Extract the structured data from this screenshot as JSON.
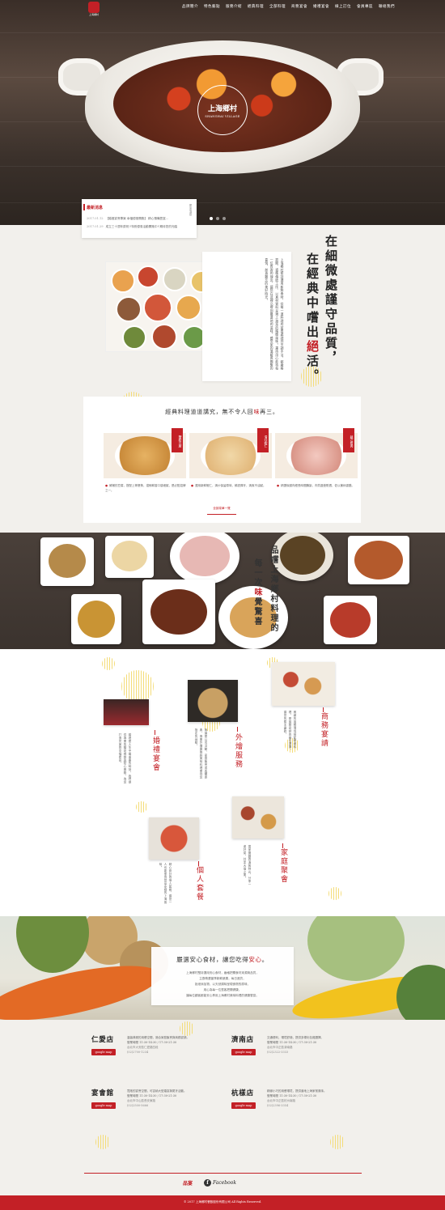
{
  "header": {
    "logo_text": "上海鄉村",
    "nav": [
      "品牌簡介",
      "特色藝點",
      "服務介紹",
      "經典料理",
      "全部料理",
      "商務宴會",
      "婚禮宴會",
      "線上訂位",
      "會員專區",
      "聯絡我們"
    ]
  },
  "hero": {
    "seal_title": "上海鄉村",
    "seal_sub": "SHANGHAI VILLAGE"
  },
  "news": {
    "title": "最新消息",
    "more": "更多消息",
    "items": [
      {
        "date": "2017.01.12",
        "text": "【婚禮宴會專案 幸福優惠開跑】 精心預備豐富..."
      },
      {
        "date": "2017.01.29",
        "text": "成立三十週年慶祝!!特別優惠活動開跑中!!期待您的光臨"
      }
    ]
  },
  "intro": {
    "slogan_col1": "在細微處謹守品質，",
    "slogan_col2_a": "在經典中嚐出",
    "slogan_col2_red": "絕",
    "slogan_col2_b": "活。",
    "body": "上海鄉村堅持選用新鮮食材，從每一道料理的前置處理到烹調手法，都嚴格把關，遵循傳統工序，以真材實料呈現上海菜的精緻風味。秉持用心款待每一位賓客的理念，讓您在這裡品嚐到最道地的滋味，感受家的溫暖與團聚的喜悅，創造難忘的美好時光。"
  },
  "classics": {
    "heading_a": "經典料理道道講究，無不令人回",
    "heading_red": "味",
    "heading_b": "再三。",
    "dishes": [
      {
        "tag": "蟹粉豆腐",
        "desc": "鮮嫩的豆腐，搭配上等蟹黃，濃郁鮮香口感細膩，是必點招牌之一。"
      },
      {
        "tag": "清炒蝦仁",
        "desc": "選用新鮮蝦仁，清炒保留原味，鮮甜彈牙，清爽不油膩。"
      },
      {
        "tag": "鎮江肴肉",
        "desc": "精選後腿肉經長時間醃製，肉質晶瑩剔透，佐以薑絲香醋。"
      }
    ],
    "more_button": "全部菜單一覽"
  },
  "spread": {
    "line1": "品嚐上海鄉村料理的",
    "line2_a": "每一次",
    "line2_red": "味",
    "line2_b": "覺驚喜"
  },
  "services": [
    {
      "title": "婚禮宴會",
      "text": "婚禮是人生中最重要的時刻，我們提供專業的婚宴規劃與貼心服務，為您打造完美的幸福饗宴。"
    },
    {
      "title": "外燴服務",
      "text": "無論是公司活動、家庭聚會或各類慶典，專業外燴團隊將美味料理帶到您指定的地點。"
    },
    {
      "title": "商務宴請",
      "text": "雅緻的用餐環境搭配精緻料理，是商務宴請的最佳選擇，讓您的賓主盡歡。"
    },
    {
      "title": "個人套餐",
      "text": "精心設計的個人套餐，讓您一人也能享用豐富多樣的上海風味。"
    },
    {
      "title": "家庭聚會",
      "text": "闔家團圓的溫馨時光，分享一桌好菜，共享天倫之樂。"
    }
  ],
  "safety": {
    "heading_a": "嚴選安心食材，讓您吃得",
    "heading_red": "安心",
    "heading_b": "。",
    "lines": [
      "上海鄉村堅持選用安心食材，嚴格把關食材來源與品質，",
      "主廚精選當季新鮮蔬果，每日進貨，",
      "拒絕添加物，以天然調味呈現食物的原味，",
      "用心為每一位賓客把關健康，",
      "讓每位顧客都能安心享用上海鄉村美味料理的健康饗宴。"
    ]
  },
  "stores": [
    {
      "name": "仁愛店",
      "map": "google map",
      "desc": "溫馨典雅的用餐空間，適合家庭聚會與商務宴請。",
      "hours": "營業時間 11:30-14:30 / 17:30-21:30",
      "addr": "台北市大安區仁愛路四段",
      "phone": "(02)2700-1234"
    },
    {
      "name": "濟南店",
      "map": "google map",
      "desc": "交通便利，環境舒適，提供多樣化包廂選擇。",
      "hours": "營業時間 11:30-14:30 / 17:30-21:30",
      "addr": "台北市中正區濟南路",
      "phone": "(02)2322-3333"
    },
    {
      "name": "宴會館",
      "map": "google map",
      "desc": "寬敞的宴會空間，可容納大型婚宴與尾牙活動。",
      "hours": "營業時間 11:30-14:30 / 17:30-21:30",
      "addr": "台北市中山區長安東路",
      "phone": "(02)2500-5666"
    },
    {
      "name": "杭樣店",
      "map": "google map",
      "desc": "精緻小巧的用餐環境，提供道地上海家常風味。",
      "hours": "營業時間 11:30-14:30 / 17:30-21:30",
      "addr": "台北市中正區杭州南路",
      "phone": "(02)2396-3354"
    }
  ],
  "footer": {
    "brand_logo": "品宴",
    "facebook": "Facebook",
    "copyright": "© 2017 上海鄉村餐飲股份有限公司 All Rights Reserved."
  },
  "colors": {
    "brand_red": "#c32026",
    "accent_yellow": "#f4dc78",
    "page_bg": "#f2f0ec"
  }
}
